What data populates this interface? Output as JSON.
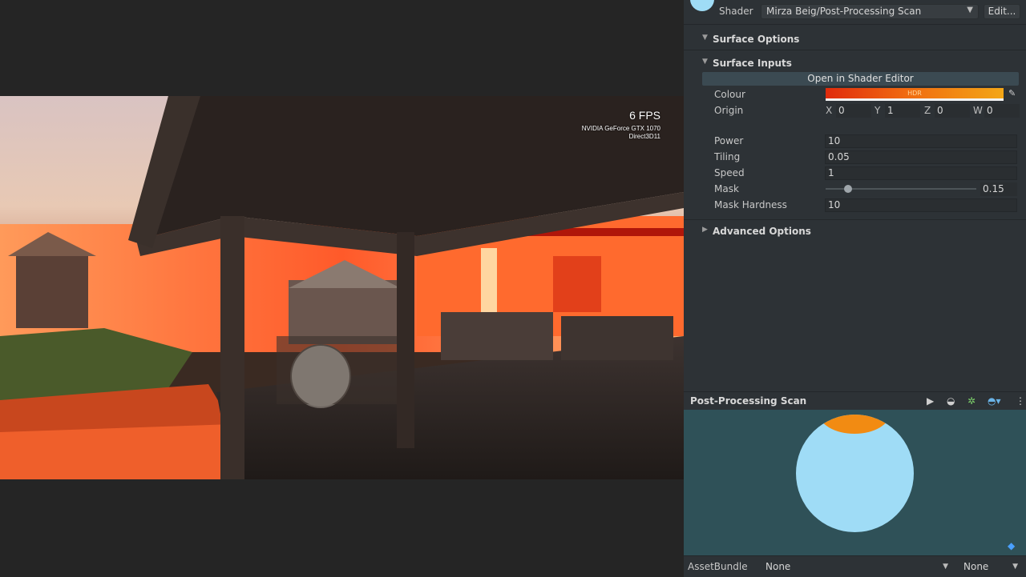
{
  "game_view": {
    "fps": "6 FPS",
    "gpu": "NVIDIA GeForce GTX 1070",
    "api": "Direct3D11"
  },
  "inspector": {
    "shader_label": "Shader",
    "shader_value": "Mirza Beig/Post-Processing Scan",
    "edit_label": "Edit...",
    "sections": {
      "surface_options": "Surface Options",
      "surface_inputs": "Surface Inputs",
      "advanced_options": "Advanced Options"
    },
    "open_shader_editor": "Open in Shader Editor",
    "colour": {
      "label": "Colour",
      "hdr": "HDR",
      "color_start": "#e02b0c",
      "color_end": "#f3a616"
    },
    "origin": {
      "label": "Origin",
      "x_label": "X",
      "x": "0",
      "y_label": "Y",
      "y": "1",
      "z_label": "Z",
      "z": "0",
      "w_label": "W",
      "w": "0"
    },
    "power": {
      "label": "Power",
      "value": "10"
    },
    "tiling": {
      "label": "Tiling",
      "value": "0.05"
    },
    "speed": {
      "label": "Speed",
      "value": "1"
    },
    "mask": {
      "label": "Mask",
      "value": "0.15"
    },
    "mask_hardness": {
      "label": "Mask Hardness",
      "value": "10"
    }
  },
  "preview": {
    "title": "Post-Processing Scan",
    "icons": [
      "play-icon",
      "sphere-icon",
      "light-icon",
      "mesh-icon",
      "more-icon"
    ]
  },
  "asset_bundle": {
    "label": "AssetBundle",
    "bundle": "None",
    "variant": "None"
  }
}
